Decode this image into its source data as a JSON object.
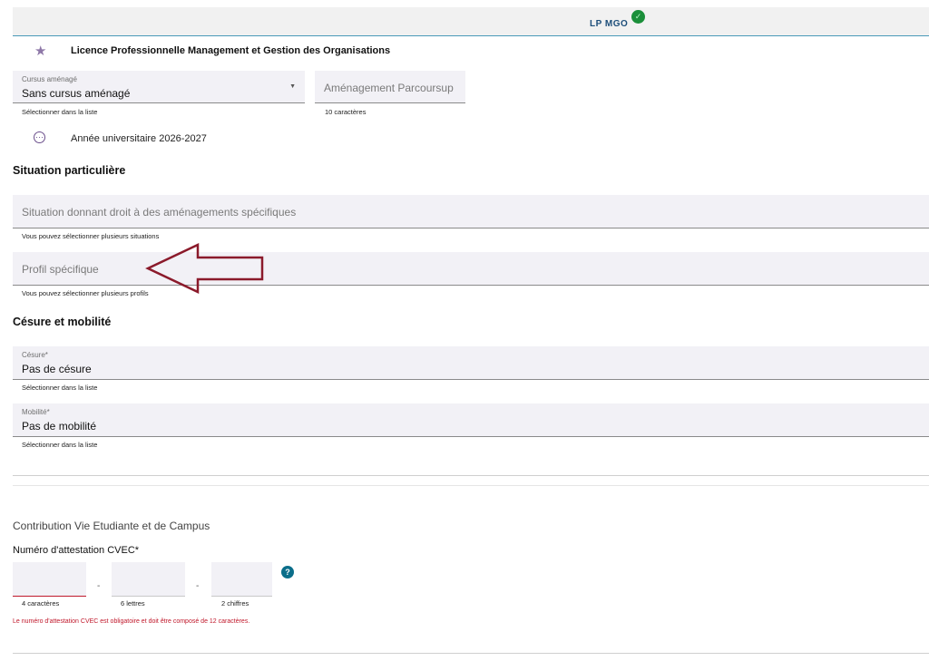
{
  "tab": {
    "label": "LP MGO",
    "status_icon": "check-circle-icon",
    "status_color": "#1b8f3a"
  },
  "formation": {
    "title": "Licence Professionnelle Management et Gestion des Organisations",
    "icon": "star-icon"
  },
  "cursus": {
    "label": "Cursus aménagé",
    "value": "Sans cursus aménagé",
    "hint": "Sélectionner dans la liste"
  },
  "parcoursup": {
    "placeholder": "Aménagement Parcoursup",
    "hint": "10 caractères"
  },
  "annee": {
    "text": "Année universitaire 2026-2027",
    "icon": "dots-circle-icon"
  },
  "situation": {
    "title": "Situation particulière",
    "amenagements": {
      "placeholder": "Situation donnant droit à des aménagements spécifiques",
      "hint": "Vous pouvez sélectionner plusieurs situations"
    },
    "profil": {
      "placeholder": "Profil spécifique",
      "hint": "Vous pouvez sélectionner plusieurs profils"
    }
  },
  "cesure_mobilite": {
    "title": "Césure et mobilité",
    "cesure": {
      "label": "Césure*",
      "value": "Pas de césure",
      "hint": "Sélectionner dans la liste"
    },
    "mobilite": {
      "label": "Mobilité*",
      "value": "Pas de mobilité",
      "hint": "Sélectionner dans la liste"
    }
  },
  "cvec": {
    "title": "Contribution Vie Etudiante et de Campus",
    "label": "Numéro d'attestation CVEC*",
    "dash": "-",
    "part1_hint": "4 caractères",
    "part2_hint": "6 lettres",
    "part3_hint": "2 chiffres",
    "help_icon": "?",
    "error": "Le numéro d'attestation CVEC est obligatoire et doit être composé de 12 caractères.",
    "error_color": "#c0182b"
  },
  "annotation": {
    "arrow_color": "#8b1a2b"
  }
}
